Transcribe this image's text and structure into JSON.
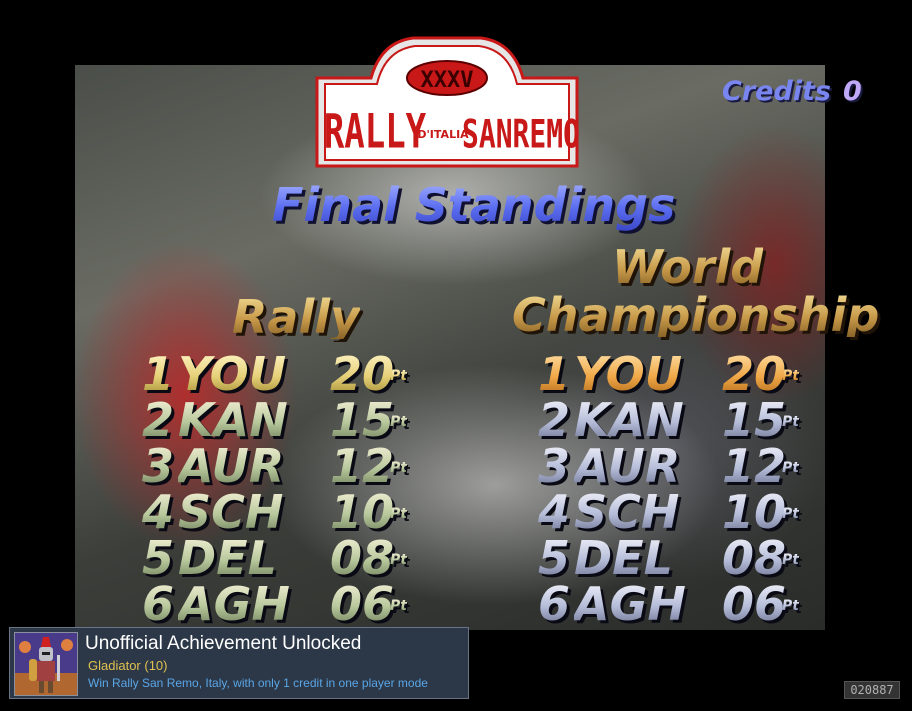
{
  "game": {
    "logo": {
      "badge_text": "XXXV",
      "left_text": "RALLY",
      "middle_text": "D'ITALIA",
      "right_text": "SANREMO",
      "colors": {
        "frame": "#e0e0e0",
        "red": "#c81818",
        "dark": "#5a0000"
      }
    },
    "credits": {
      "label": "Credits",
      "value": "0"
    },
    "title": "Final Standings",
    "columns": {
      "rally": {
        "heading": "Rally",
        "rows": [
          {
            "pos": "1",
            "name": "YOU",
            "pts": "20",
            "unit": "Pt"
          },
          {
            "pos": "2",
            "name": "KAN",
            "pts": "15",
            "unit": "Pt"
          },
          {
            "pos": "3",
            "name": "AUR",
            "pts": "12",
            "unit": "Pt"
          },
          {
            "pos": "4",
            "name": "SCH",
            "pts": "10",
            "unit": "Pt"
          },
          {
            "pos": "5",
            "name": "DEL",
            "pts": "08",
            "unit": "Pt"
          },
          {
            "pos": "6",
            "name": "AGH",
            "pts": "06",
            "unit": "Pt"
          }
        ]
      },
      "world": {
        "heading_line1": "World",
        "heading_line2": "Championship",
        "rows": [
          {
            "pos": "1",
            "name": "YOU",
            "pts": "20",
            "unit": "Pt"
          },
          {
            "pos": "2",
            "name": "KAN",
            "pts": "15",
            "unit": "Pt"
          },
          {
            "pos": "3",
            "name": "AUR",
            "pts": "12",
            "unit": "Pt"
          },
          {
            "pos": "4",
            "name": "SCH",
            "pts": "10",
            "unit": "Pt"
          },
          {
            "pos": "5",
            "name": "DEL",
            "pts": "08",
            "unit": "Pt"
          },
          {
            "pos": "6",
            "name": "AGH",
            "pts": "06",
            "unit": "Pt"
          }
        ]
      }
    }
  },
  "achievement": {
    "header": "Unofficial Achievement Unlocked",
    "name": "Gladiator (10)",
    "description": "Win Rally San Remo, Italy, with only 1 credit in one player mode",
    "badge_icon": "gladiator-badge-icon"
  },
  "frame_counter": "020887"
}
